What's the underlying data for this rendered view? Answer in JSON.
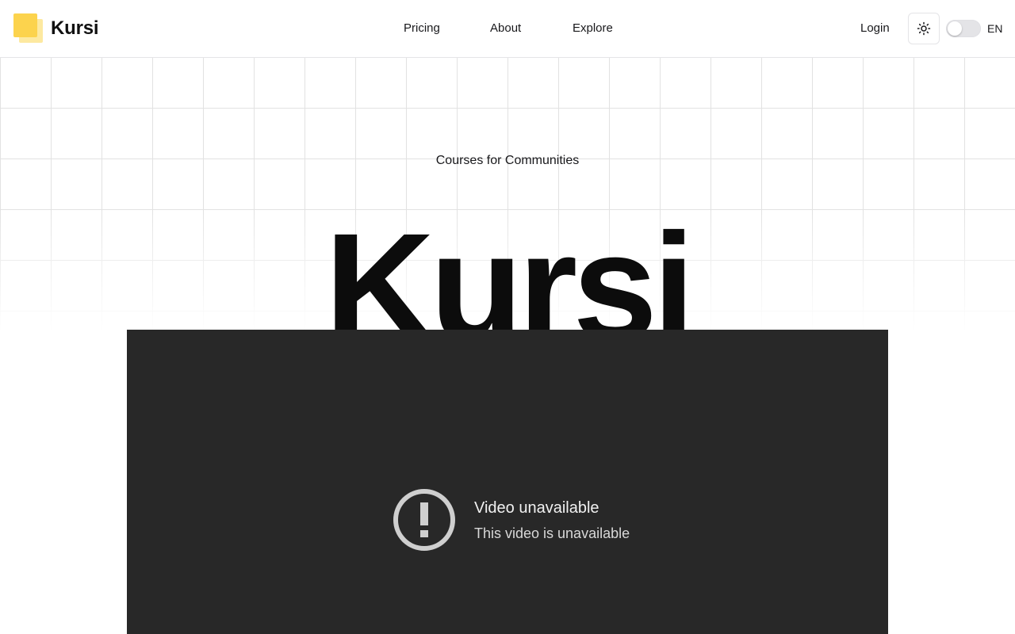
{
  "header": {
    "brand": "Kursi",
    "nav": [
      {
        "label": "Pricing"
      },
      {
        "label": "About"
      },
      {
        "label": "Explore"
      }
    ],
    "login_label": "Login",
    "theme_icon": "sun-icon",
    "language": "EN"
  },
  "hero": {
    "tagline": "Courses for Communities",
    "title": "Kursi"
  },
  "video": {
    "icon": "alert-circle-icon",
    "title": "Video unavailable",
    "subtitle": "This video is unavailable"
  },
  "colors": {
    "brand_yellow": "#fcd34d",
    "brand_yellow_light": "#fde9a0",
    "video_bg": "#282828"
  }
}
